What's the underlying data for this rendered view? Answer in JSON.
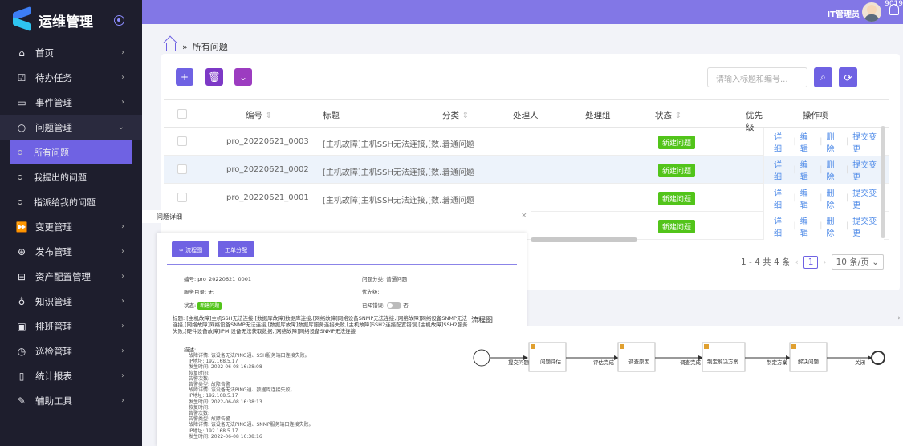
{
  "app": {
    "title": "运维管理"
  },
  "topbar": {
    "user": "IT管理员",
    "notify_count": "9019"
  },
  "sidebar": {
    "items": [
      {
        "label": "首页",
        "icon": "home-icon"
      },
      {
        "label": "待办任务",
        "icon": "checkbox-icon"
      },
      {
        "label": "事件管理",
        "icon": "monitor-icon"
      },
      {
        "label": "问题管理",
        "icon": "chat-icon",
        "open": true
      },
      {
        "label": "变更管理",
        "icon": "fast-forward-icon"
      },
      {
        "label": "发布管理",
        "icon": "globe-icon"
      },
      {
        "label": "资产配置管理",
        "icon": "box-icon"
      },
      {
        "label": "知识管理",
        "icon": "bulb-icon"
      },
      {
        "label": "排班管理",
        "icon": "calendar-icon"
      },
      {
        "label": "巡检管理",
        "icon": "clock-icon"
      },
      {
        "label": "统计报表",
        "icon": "report-icon"
      },
      {
        "label": "辅助工具",
        "icon": "tool-icon"
      }
    ],
    "sub_items": [
      {
        "label": "所有问题",
        "active": true
      },
      {
        "label": "我提出的问题"
      },
      {
        "label": "指派给我的问题"
      }
    ]
  },
  "breadcrumb": {
    "sep": "»",
    "current": "所有问题"
  },
  "search": {
    "placeholder": "请输入标题和编号..."
  },
  "table": {
    "headers": [
      "编号",
      "标题",
      "分类",
      "处理人",
      "处理组",
      "状态",
      "优先级",
      "操作项"
    ],
    "rows": [
      {
        "id": "pro_20220621_0003",
        "title": "[主机故障]主机SSH无法连接,[数...",
        "category": "普通问题",
        "status": "新建问题"
      },
      {
        "id": "pro_20220621_0002",
        "title": "[主机故障]主机SSH无法连接,[数...",
        "category": "普通问题",
        "status": "新建问题"
      },
      {
        "id": "pro_20220621_0001",
        "title": "[主机故障]主机SSH无法连接,[数...",
        "category": "普通问题",
        "status": "新建问题"
      },
      {
        "id": "",
        "title": "",
        "category": "",
        "status": "新建问题"
      }
    ],
    "ops": [
      "详细",
      "编辑",
      "删除",
      "提交变更"
    ]
  },
  "pager": {
    "summary": "1 - 4 共 4 条",
    "page": "1",
    "size": "10 条/页"
  },
  "drawer": {
    "title": "问题详细",
    "close": "×",
    "buttons": [
      "流程图",
      "工单分配"
    ],
    "fields": {
      "id_label": "编号:",
      "id": "pro_20220621_0001",
      "cat_label": "问题分类:",
      "cat": "普通问题",
      "svc_label": "服务目录:",
      "svc": "无",
      "pri_label": "优先级:",
      "state_label": "状态:",
      "state": "新建问题",
      "known_label": "已知错误:",
      "known": "否",
      "title_label": "标题:",
      "title": "[主机故障]主机SSH无法连接,[数据库故障]数据库连接,[网络故障]网络设备SNMP无法连接,[网络故障]网络设备SNMP无法连接,[网络故障]网络设备SNMP无法连接,[数据库故障]数据库服务连接失败,[主机故障]SSH2连接配置错误,[主机故障]SSH2服务失败,[硬件设备故障]IPMI设备无法获取数据,[网络故障]网络设备SNMP无法连接",
      "desc_label": "描述:"
    },
    "desc_lines": [
      "故障详情: 该设备无法PING通、SSH服务端口连接失败。",
      "IP地址: 192.168.5.17",
      "发生时间: 2022-06-08 16:38:08",
      "恢复时间:",
      "告警次数:",
      "告警类型: 故障告警",
      "故障详情: 该设备无法PING通、数据库连接失败。",
      "IP地址: 192.168.5.17",
      "发生时间: 2022-06-08 16:38:13",
      "恢复时间:",
      "告警次数:",
      "告警类型: 故障告警",
      "故障详情: 该设备无法PING通、SNMP服务端口连接失败。",
      "IP地址: 192.168.5.17",
      "发生时间: 2022-06-08 16:38:16"
    ]
  },
  "flow": {
    "title": "流程图",
    "nodes": [
      "问题评估",
      "调查原因",
      "制定解决方案",
      "解决问题"
    ],
    "edges": [
      "提交问题",
      "评估完成",
      "调查完成",
      "制定方案",
      "关闭"
    ]
  }
}
